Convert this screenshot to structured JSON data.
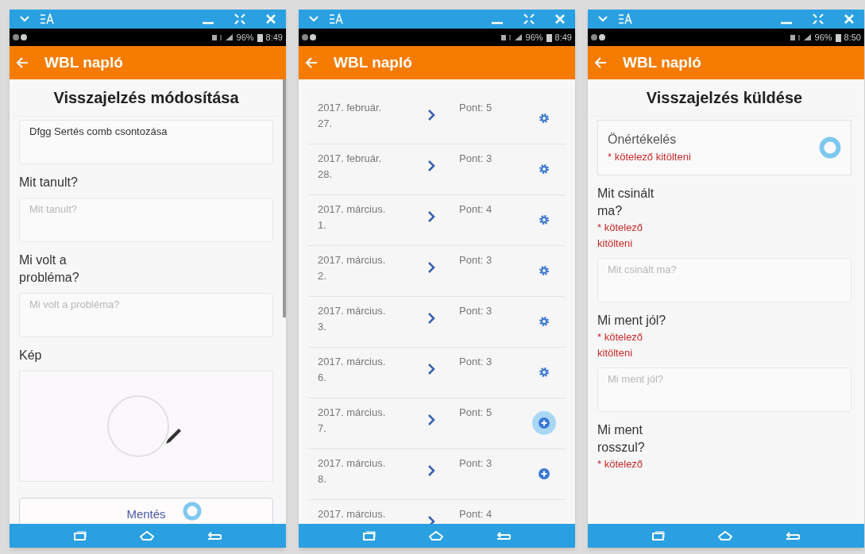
{
  "screens": [
    {
      "status": {
        "battery": "96%",
        "time": "8:49"
      },
      "app_bar": {
        "title": "WBL napló"
      },
      "content": {
        "kind": "form",
        "items": [
          {
            "kind": "heading",
            "text": "Visszajelzés módosítása"
          },
          {
            "kind": "textarea",
            "value": "Dfgg  Sertés comb csontozása"
          },
          {
            "kind": "label",
            "text": "Mit tanult?"
          },
          {
            "kind": "textarea",
            "placeholder": "Mit tanult?"
          },
          {
            "kind": "label",
            "text": "Mi volt a probléma?"
          },
          {
            "kind": "textarea",
            "placeholder": "Mi volt a probléma?"
          },
          {
            "kind": "label",
            "text": "Kép"
          },
          {
            "kind": "image"
          },
          {
            "kind": "button",
            "text": "Mentés"
          }
        ]
      }
    },
    {
      "status": {
        "battery": "96%",
        "time": "8:49"
      },
      "app_bar": {
        "title": "WBL napló"
      },
      "content": {
        "kind": "list",
        "rows": [
          {
            "date": "2017. február. 27.",
            "points": "Pont: 5",
            "kind": "gear",
            "pressed": false
          },
          {
            "date": "2017. február. 28.",
            "points": "Pont: 3",
            "kind": "gear",
            "pressed": false
          },
          {
            "date": "2017. március. 1.",
            "points": "Pont: 4",
            "kind": "gear",
            "pressed": false
          },
          {
            "date": "2017. március. 2.",
            "points": "Pont: 3",
            "kind": "gear",
            "pressed": false
          },
          {
            "date": "2017. március. 3.",
            "points": "Pont: 3",
            "kind": "gear",
            "pressed": false
          },
          {
            "date": "2017. március. 6.",
            "points": "Pont: 3",
            "kind": "gear",
            "pressed": false
          },
          {
            "date": "2017. március. 7.",
            "points": "Pont: 5",
            "kind": "plus",
            "pressed": true
          },
          {
            "date": "2017. március. 8.",
            "points": "Pont: 3",
            "kind": "plus",
            "pressed": false
          },
          {
            "date": "2017. március.",
            "points": "Pont: 4",
            "kind": "none"
          }
        ]
      }
    },
    {
      "status": {
        "battery": "96%",
        "time": "8:50"
      },
      "app_bar": {
        "title": "WBL napló"
      },
      "content": {
        "kind": "form",
        "items": [
          {
            "kind": "heading",
            "text": "Visszajelzés küldése"
          },
          {
            "kind": "rating_card",
            "text": "Önértékelés",
            "required": "* kötelező kitölteni"
          },
          {
            "kind": "label",
            "text": "Mit csinált ma?",
            "required": "* kötelező kitölteni"
          },
          {
            "kind": "textarea",
            "placeholder": "Mit csinált ma?"
          },
          {
            "kind": "label",
            "text": "Mi ment jól?",
            "required": "* kötelező kitölteni"
          },
          {
            "kind": "textarea",
            "placeholder": "Mi ment jól?"
          },
          {
            "kind": "label",
            "text": "Mi ment rosszul?",
            "required": "* kötelező"
          }
        ]
      }
    }
  ]
}
